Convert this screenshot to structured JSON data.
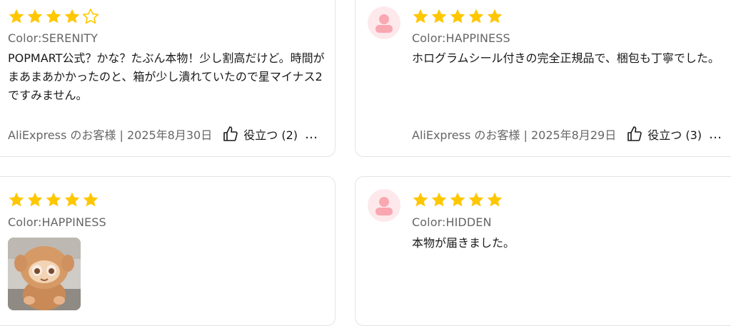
{
  "colors": {
    "star": "#ffc700",
    "accent_avatar": "#f9a7b0"
  },
  "reviews": [
    {
      "rating": 4,
      "color": "Color:SERENITY",
      "text": "POPMART公式？かな？たぶん本物！少し割高だけど。時間がまあまあかかったのと、箱が少し潰れていたので星マイナス2ですみません。",
      "meta": "AliExpress のお客様 | 2025年8月30日",
      "helpful": "役立つ (2)",
      "more": "…"
    },
    {
      "rating": 5,
      "avatar": "user-avatar",
      "color": "Color:HAPPINESS",
      "text": "ホログラムシール付きの完全正規品で、梱包も丁寧でした。",
      "meta": "AliExpress のお客様 | 2025年8月29日",
      "helpful": "役立つ (3)",
      "more": "…"
    },
    {
      "rating": 5,
      "color": "Color:HAPPINESS",
      "photo": "review-photo-plush-doll"
    },
    {
      "rating": 5,
      "avatar": "user-avatar",
      "color": "Color:HIDDEN",
      "text": "本物が届きました。"
    }
  ]
}
